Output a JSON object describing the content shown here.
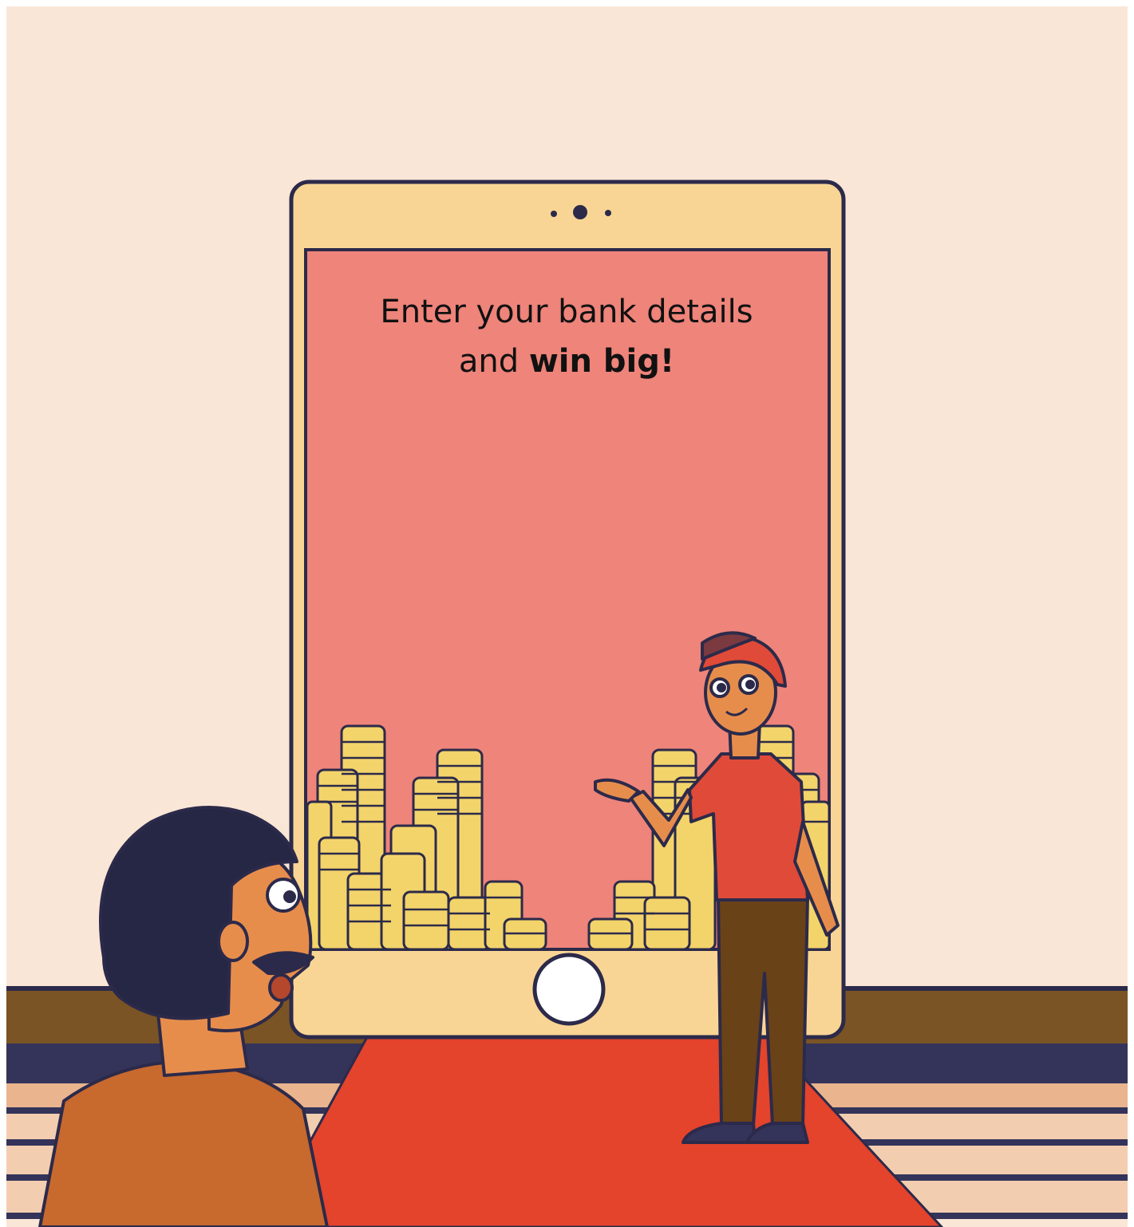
{
  "illustration": {
    "headline_line1": "Enter your bank details",
    "headline_line2_prefix": "and ",
    "headline_line2_emphasis": "win big!"
  },
  "colors": {
    "background": "#fae6d6",
    "tablet_frame": "#f9d595",
    "tablet_screen": "#ee847a",
    "outline": "#2c2a4a",
    "coin": "#f3d46a",
    "red_carpet": "#e4432c",
    "shelf_brown": "#7a5424",
    "navy": "#34345a",
    "skin": "#e78d4c",
    "shirt_left": "#c8692e",
    "shirt_right": "#e04a38",
    "trousers": "#6a4218"
  }
}
